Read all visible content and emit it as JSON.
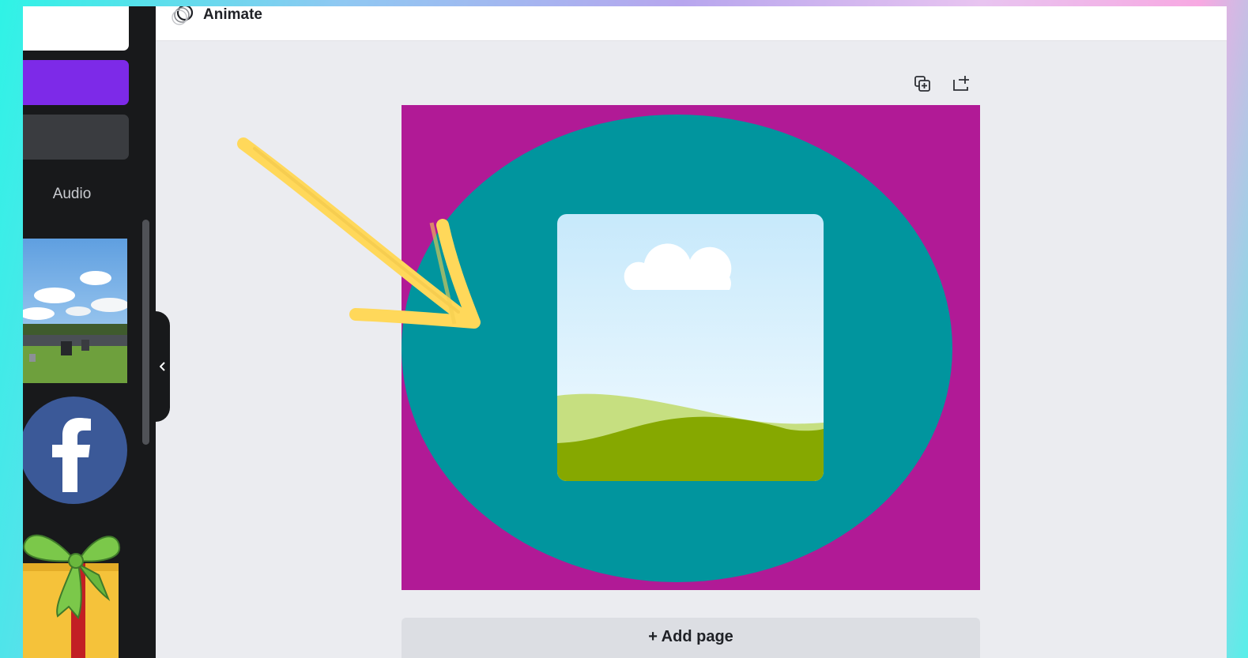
{
  "toolbar": {
    "animate_label": "Animate"
  },
  "sidebar": {
    "audio_label": "Audio",
    "collapse_icon": "chevron-left-icon"
  },
  "page_actions": {
    "duplicate_icon": "duplicate-page-icon",
    "add_icon": "add-page-icon"
  },
  "canvas": {
    "background_color": "#b11a96",
    "circle_color": "#01959e"
  },
  "footer": {
    "add_page_label": "+ Add page"
  },
  "colors": {
    "accent_purple": "#7d2ae8",
    "annotation_arrow": "#ffd85a"
  }
}
